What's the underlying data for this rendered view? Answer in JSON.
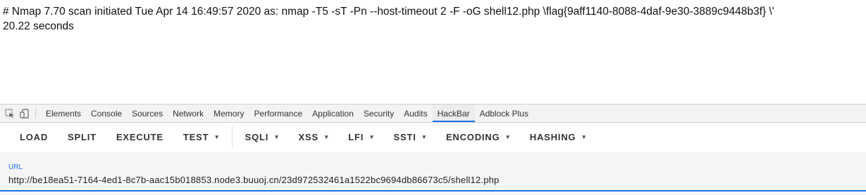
{
  "page": {
    "line1": "# Nmap 7.70 scan initiated Tue Apr 14 16:49:57 2020 as: nmap -T5 -sT -Pn --host-timeout 2 -F -oG shell12.php \\flag{9aff1140-8088-4daf-9e30-3889c9448b3f} \\'",
    "line2": "20.22 seconds"
  },
  "devtools": {
    "icons": [
      "inspect-element-icon",
      "device-toggle-icon"
    ],
    "tabs": [
      {
        "label": "Elements"
      },
      {
        "label": "Console"
      },
      {
        "label": "Sources"
      },
      {
        "label": "Network"
      },
      {
        "label": "Memory"
      },
      {
        "label": "Performance"
      },
      {
        "label": "Application"
      },
      {
        "label": "Security"
      },
      {
        "label": "Audits"
      },
      {
        "label": "HackBar",
        "active": true
      },
      {
        "label": "Adblock Plus"
      }
    ],
    "active_tab_color": "#1a73e8"
  },
  "hackbar": {
    "buttons": {
      "load": "LOAD",
      "split": "SPLIT",
      "execute": "EXECUTE",
      "test": "TEST",
      "sqli": "SQLI",
      "xss": "XSS",
      "lfi": "LFI",
      "ssti": "SSTI",
      "encoding": "ENCODING",
      "hashing": "HASHING"
    },
    "dropdown_caret": "▾",
    "url_label": "URL",
    "url_value": "http://be18ea51-7164-4ed1-8c7b-aac15b018853.node3.buuoj.cn/23d972532461a1522bc9694db86673c5/shell12.php",
    "accent_color": "#1a73e8"
  }
}
